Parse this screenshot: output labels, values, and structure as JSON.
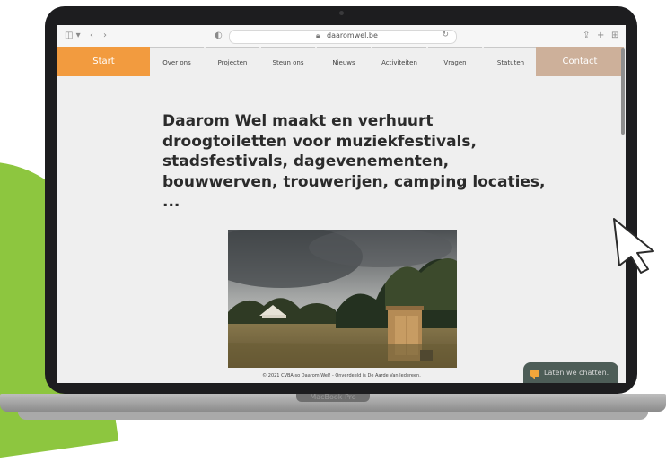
{
  "browser": {
    "url": "daaromwel.be"
  },
  "nav": {
    "start": "Start",
    "items": [
      "Over ons",
      "Projecten",
      "Steun ons",
      "Nieuws",
      "Activiteiten",
      "Vragen",
      "Statuten"
    ],
    "contact": "Contact"
  },
  "hero": {
    "headline": "Daarom Wel maakt en verhuurt droogtoiletten voor muziekfestivals, stadsfestivals, dagevenementen, bouwwerven, trouwerijen, camping locaties, ..."
  },
  "footer": {
    "text": "© 2021 CVBA-so Daarom Wel! - Onverdeeld is De Aarde Van Iedereen."
  },
  "chat": {
    "label": "Laten we chatten."
  },
  "device": {
    "label": "MacBook Pro"
  },
  "colors": {
    "start_orange": "#f29b3f",
    "contact_tan": "#cdb09a",
    "chat_green": "#4d5d57",
    "bg_green": "#8dc63f"
  }
}
